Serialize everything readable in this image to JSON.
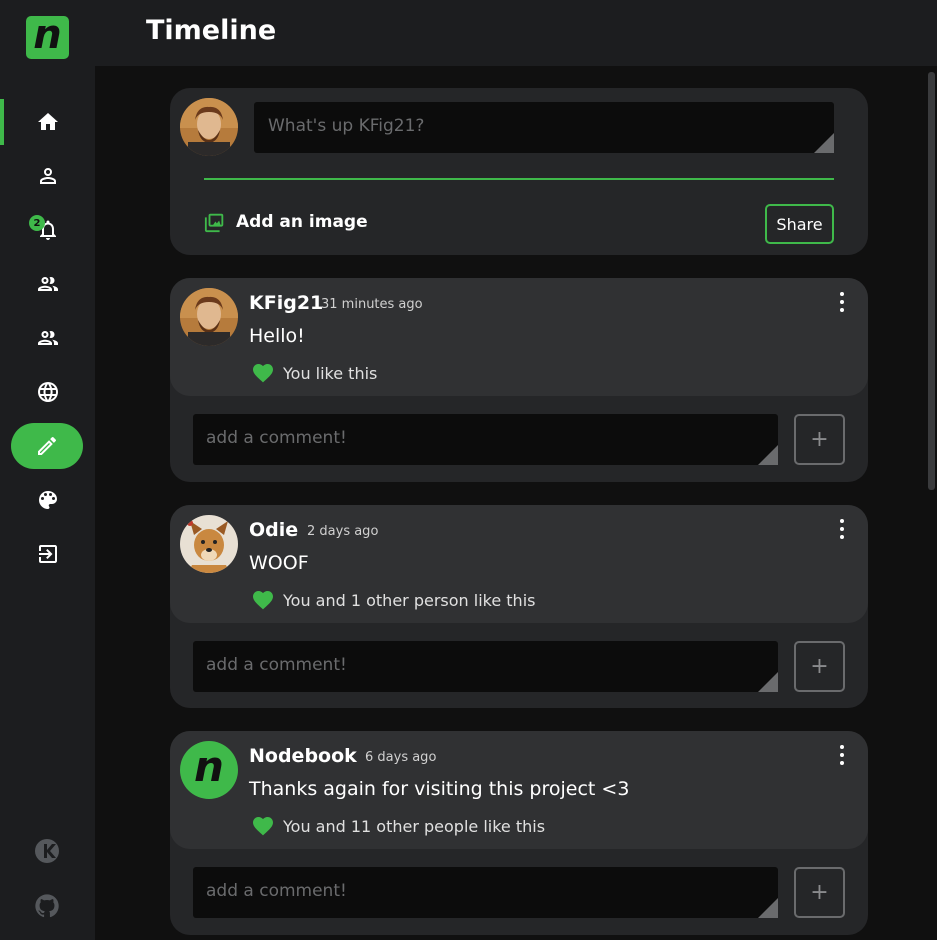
{
  "app": {
    "logo_letter": "n",
    "accent_color": "#3fb94a"
  },
  "header": {
    "title": "Timeline"
  },
  "sidebar": {
    "items": [
      {
        "icon": "home-icon",
        "active": true
      },
      {
        "icon": "person-icon"
      },
      {
        "icon": "bell-icon",
        "badge": "2"
      },
      {
        "icon": "people-icon"
      },
      {
        "icon": "people-icon"
      },
      {
        "icon": "globe-icon"
      },
      {
        "icon": "pencil-icon",
        "highlighted": true
      },
      {
        "icon": "palette-icon"
      },
      {
        "icon": "logout-icon"
      }
    ],
    "footer": [
      {
        "icon": "k-logo-icon"
      },
      {
        "icon": "github-icon"
      }
    ]
  },
  "composer": {
    "placeholder": "What's up KFig21?",
    "add_image_label": "Add an image",
    "share_label": "Share"
  },
  "posts": [
    {
      "author": "KFig21",
      "time": "31 minutes ago",
      "text": "Hello!",
      "likes": "You like this",
      "comment_placeholder": "add a comment!",
      "add_label": "+"
    },
    {
      "author": "Odie",
      "time": "2 days ago",
      "text": "WOOF",
      "likes": "You and 1 other person like this",
      "comment_placeholder": "add a comment!",
      "add_label": "+"
    },
    {
      "author": "Nodebook",
      "time": "6 days ago",
      "text": "Thanks again for visiting this project <3",
      "likes": "You and 11 other people like this",
      "comment_placeholder": "add a comment!",
      "add_label": "+"
    }
  ]
}
